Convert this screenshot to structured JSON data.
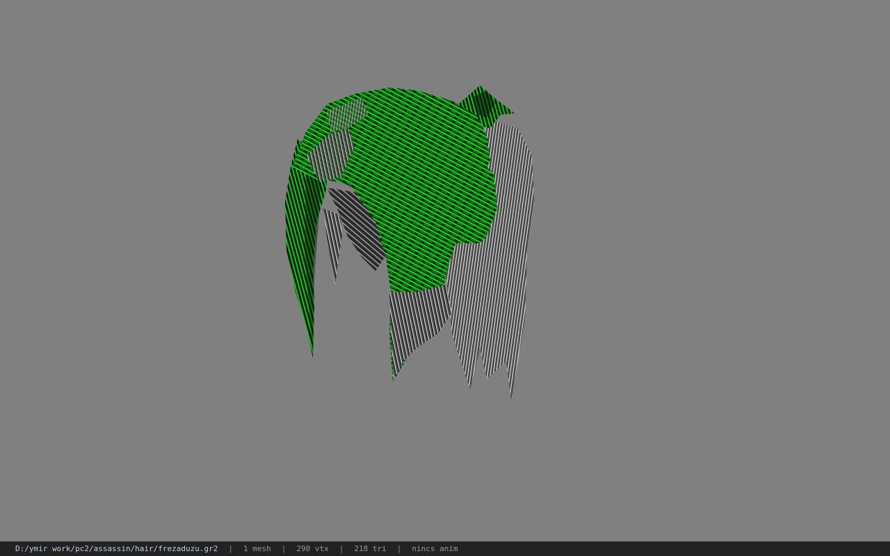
{
  "viewport": {
    "background_color": "#808080",
    "model": {
      "name": "frezaduzu",
      "primary_color": "#17c41a",
      "secondary_color": "#c0c0c0",
      "shadow_color": "#141414"
    }
  },
  "status_bar": {
    "file_path": "D:/ymir work/pc2/assassin/hair/frezaduzu.gr2",
    "separator": "|",
    "mesh_count": "1 mesh",
    "vertex_count": "290 vtx",
    "triangle_count": "218 tri",
    "animation_status": "nincs anim"
  }
}
